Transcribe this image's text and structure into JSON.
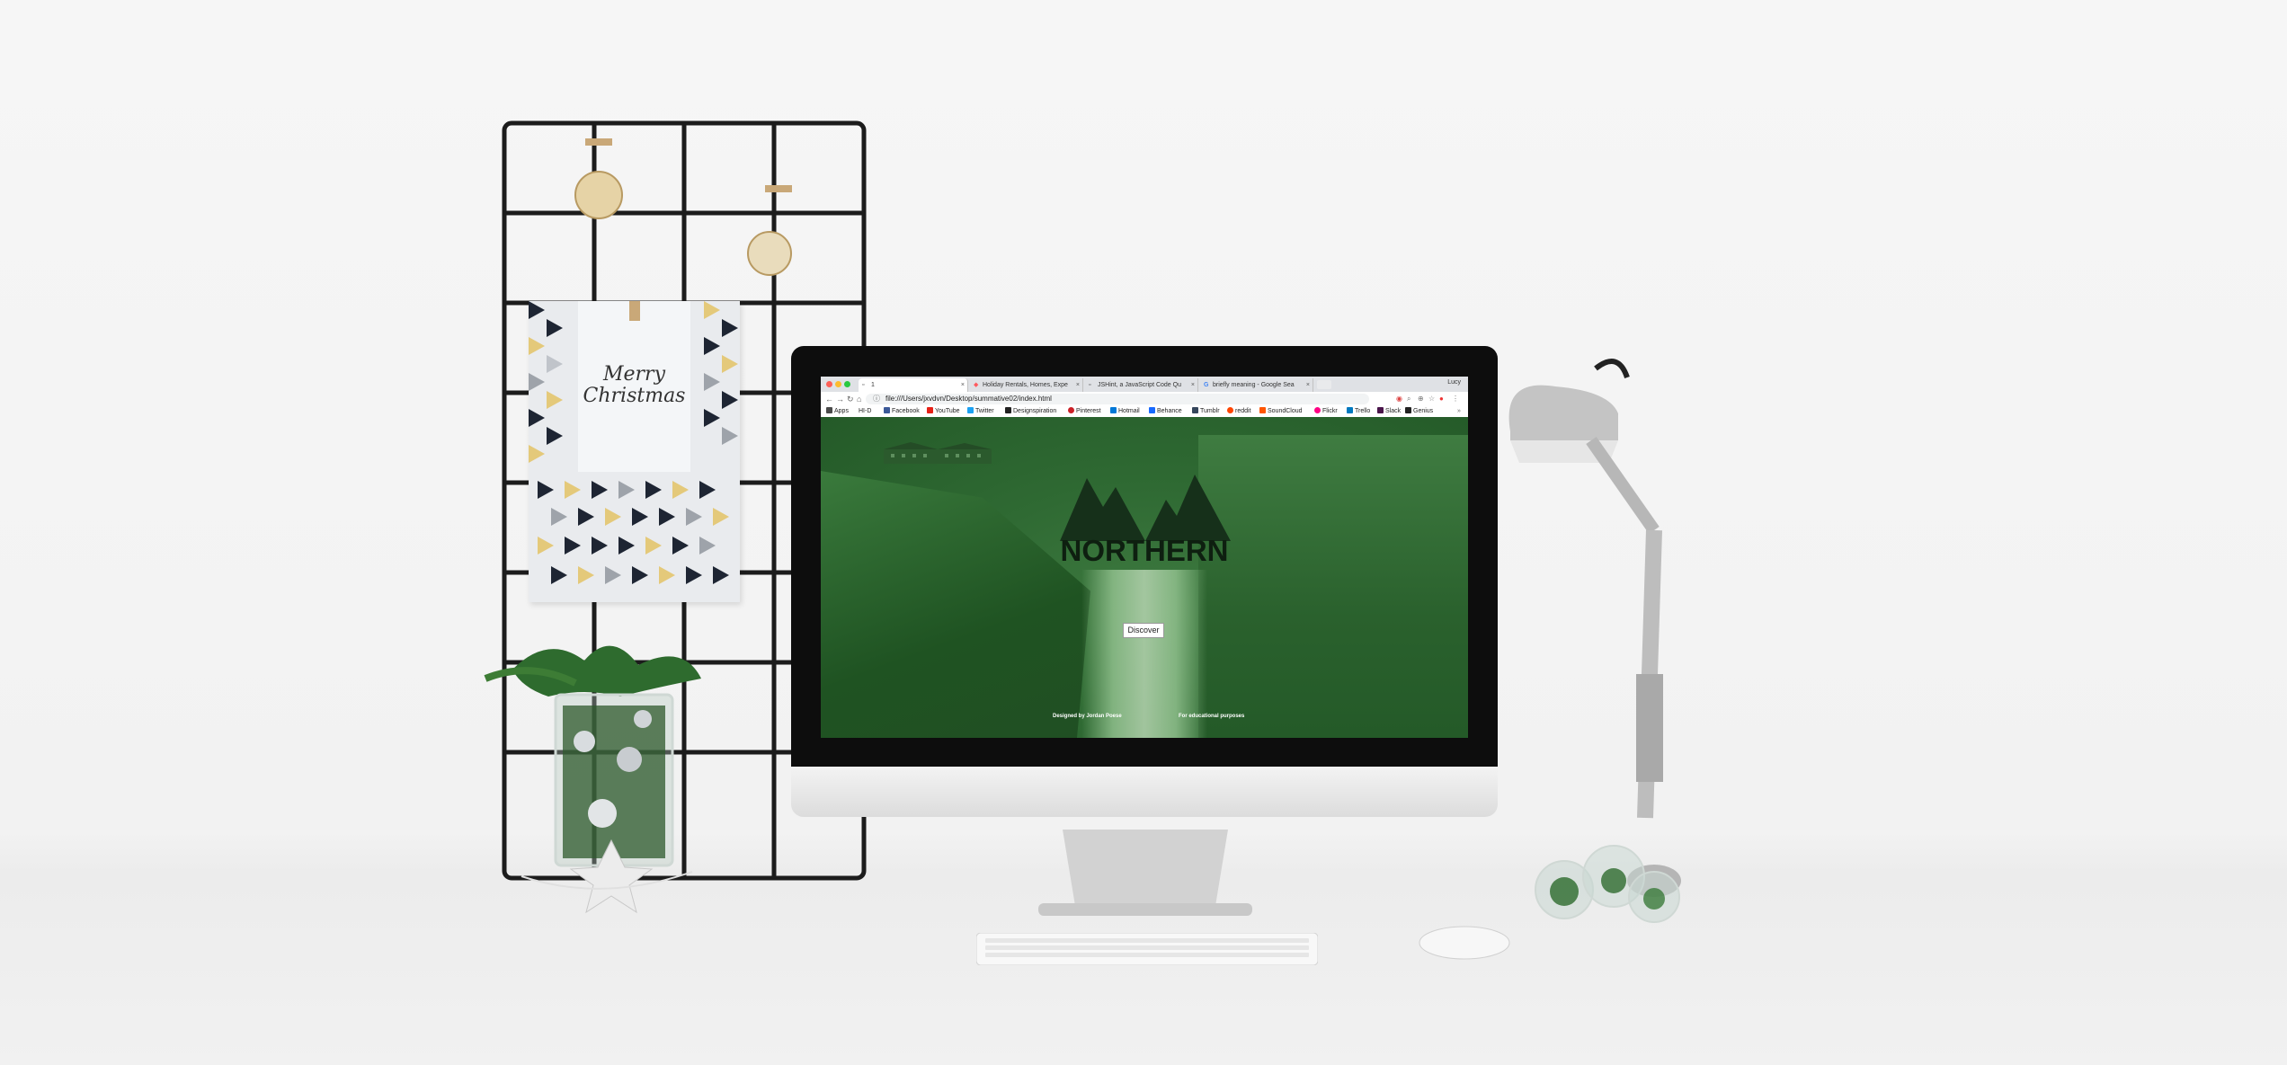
{
  "browser": {
    "profile_name": "Lucy",
    "tabs": [
      {
        "label": "1",
        "icon": "document-icon",
        "active": true
      },
      {
        "label": "Holiday Rentals, Homes, Expe",
        "icon": "airbnb-icon",
        "active": false
      },
      {
        "label": "JSHint, a JavaScript Code Qu",
        "icon": "document-icon",
        "active": false
      },
      {
        "label": "briefly meaning - Google Sea",
        "icon": "google-icon",
        "active": false
      }
    ],
    "url": "file:///Users/jxvdvn/Desktop/summative02/index.html",
    "bookmarks": [
      {
        "label": "Apps",
        "color": "#4a4a4a"
      },
      {
        "label": "HI-D",
        "color": "#777777"
      },
      {
        "label": "Facebook",
        "color": "#3b5998"
      },
      {
        "label": "YouTube",
        "color": "#e62117"
      },
      {
        "label": "Twitter",
        "color": "#1da1f2"
      },
      {
        "label": "Designspiration",
        "color": "#222222"
      },
      {
        "label": "Pinterest",
        "color": "#cb2027"
      },
      {
        "label": "Hotmail",
        "color": "#0078d7"
      },
      {
        "label": "Behance",
        "color": "#1769ff"
      },
      {
        "label": "Tumblr",
        "color": "#35465c"
      },
      {
        "label": "reddit",
        "color": "#ff4500"
      },
      {
        "label": "SoundCloud",
        "color": "#ff5500"
      },
      {
        "label": "Flickr",
        "color": "#ff0084"
      },
      {
        "label": "Trello",
        "color": "#0079bf"
      },
      {
        "label": "Slack",
        "color": "#4a154b"
      },
      {
        "label": "Genius",
        "color": "#222222"
      }
    ]
  },
  "website": {
    "logo_text": "NORTHERN",
    "cta_label": "Discover",
    "footer_left": "Designed by Jordan Poese",
    "footer_right": "For educational purposes",
    "overlay_color": "#2f6a33"
  },
  "greeting_card": {
    "text": "Merry Christmas"
  }
}
